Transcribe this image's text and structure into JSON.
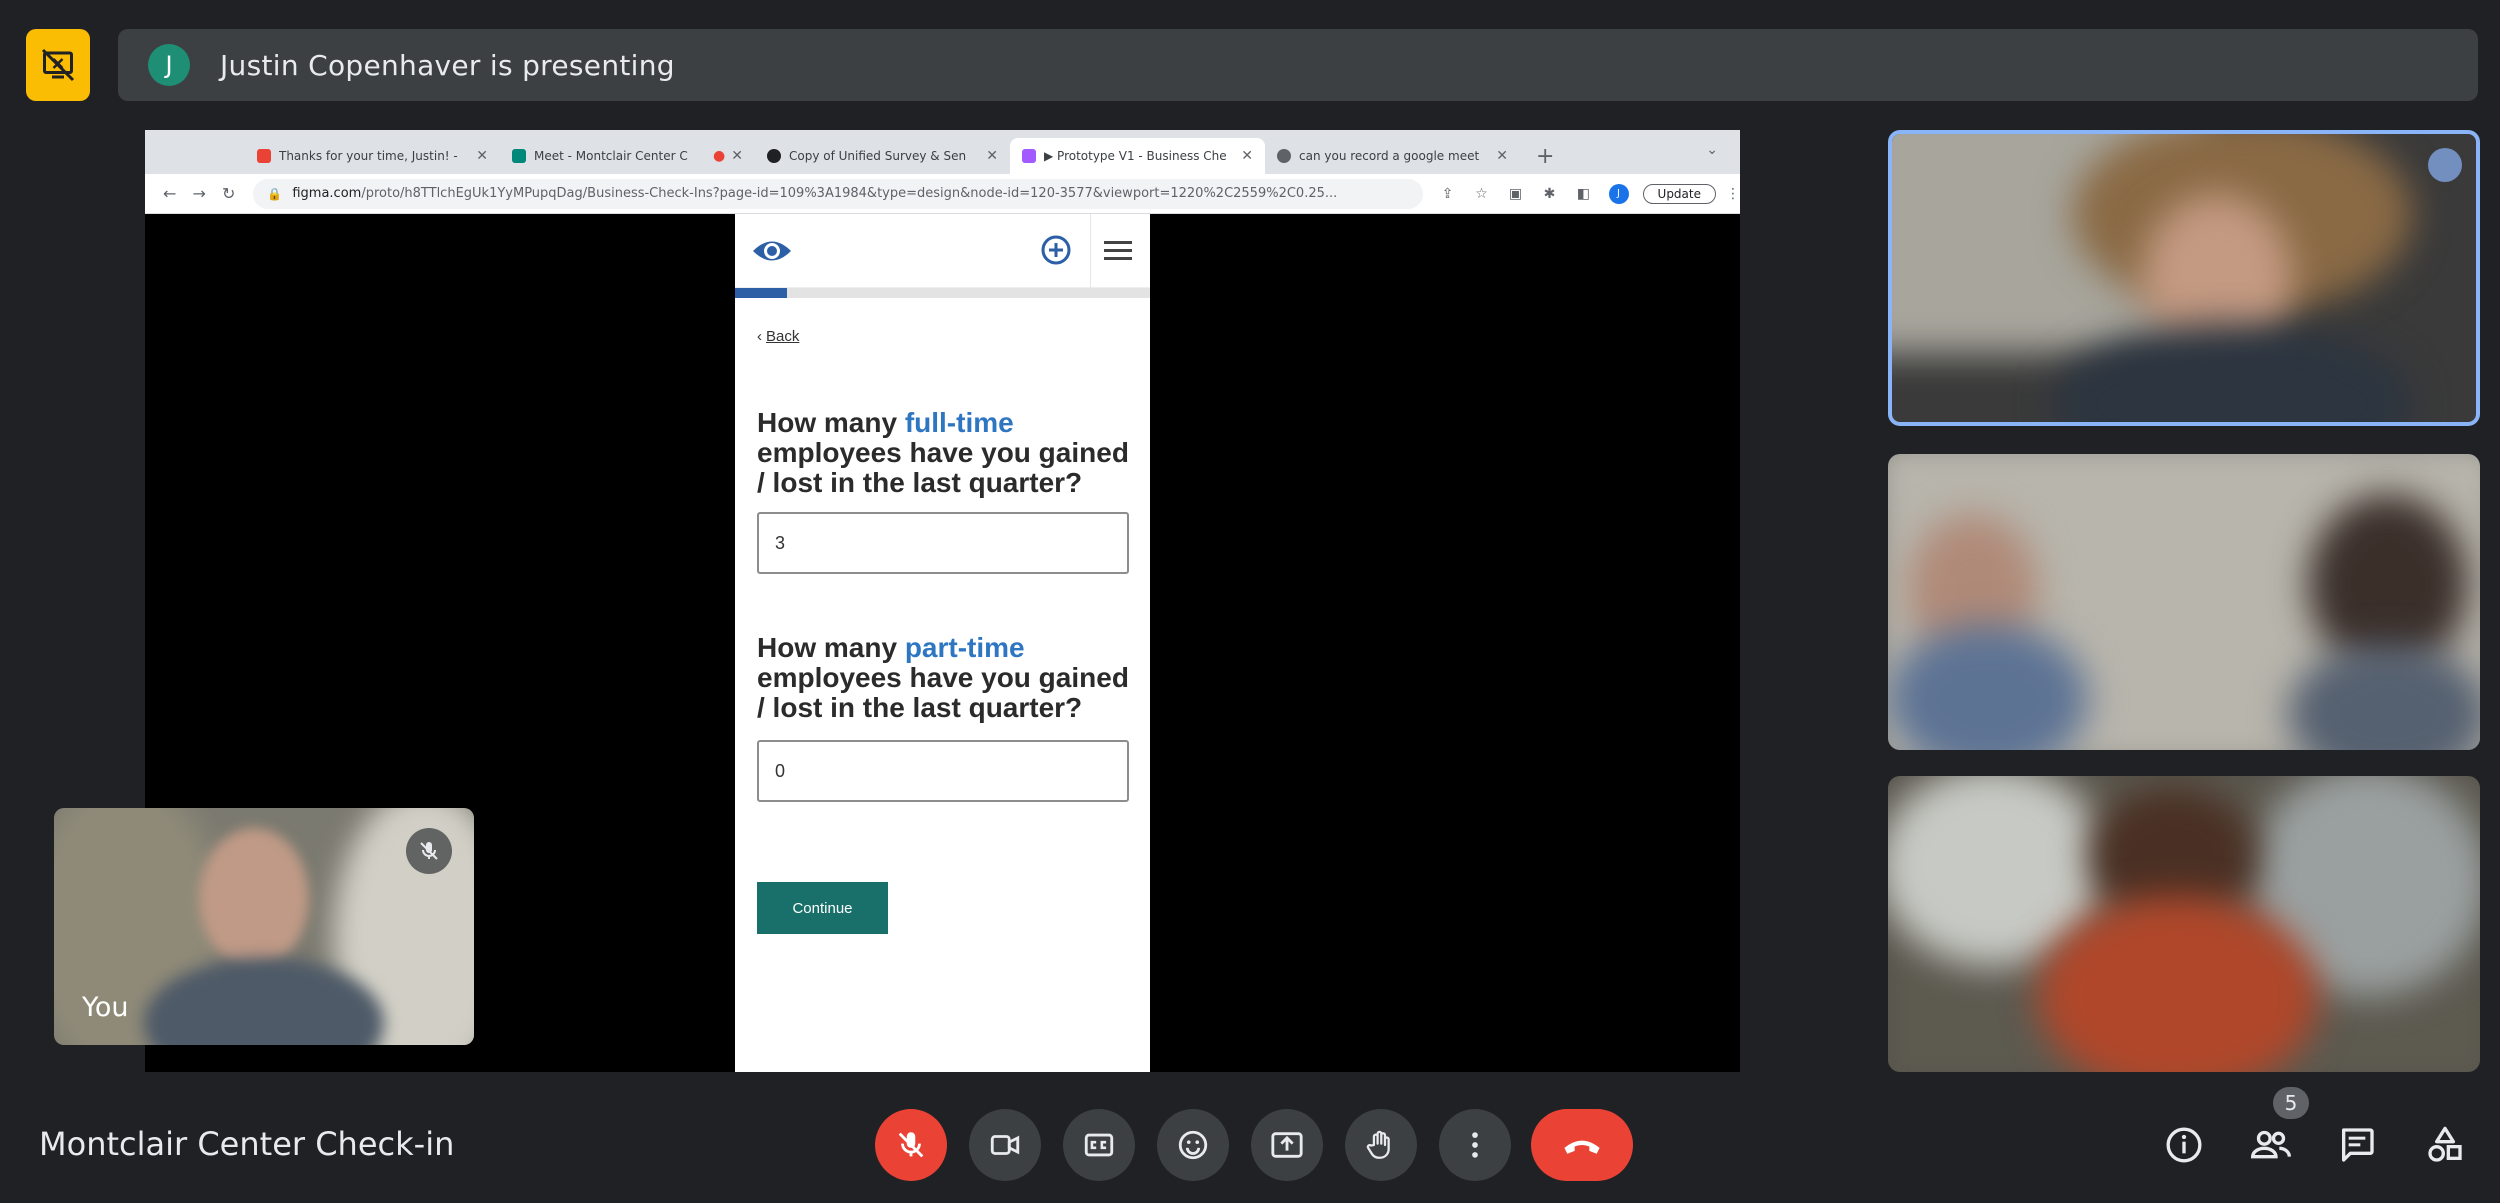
{
  "presenter": {
    "initial": "J",
    "text": "Justin Copenhaver is presenting"
  },
  "browser": {
    "tabs": [
      {
        "label": "Thanks for your time, Justin! -",
        "icon_color": "#ea4335"
      },
      {
        "label": "Meet - Montclair Center C",
        "icon_color": "#00897b"
      },
      {
        "label": "Copy of Unified Survey & Sen",
        "icon_color": "#202124"
      },
      {
        "label": "▶ Prototype V1 - Business Che",
        "icon_color": "#a259ff"
      },
      {
        "label": "can you record a google meet",
        "icon_color": "#5f6368"
      }
    ],
    "url_host": "figma.com",
    "url_path": "/proto/h8TTlchEgUk1YyMPupqDag/Business-Check-Ins?page-id=109%3A1984&type=design&node-id=120-3577&viewport=1220%2C2559%2C0.25...",
    "profile_initial": "J",
    "update_label": "Update"
  },
  "prototype": {
    "progress": 0.125,
    "back_label": "Back",
    "q1": {
      "pre": "How many ",
      "highlight": "full-time",
      "post": " employees have you gained / lost in the last quarter?",
      "value": "3"
    },
    "q2": {
      "pre": "How many ",
      "highlight": "part-time",
      "post": " employees have you gained / lost in the last quarter?",
      "value": "0"
    },
    "continue_label": "Continue"
  },
  "self_view": {
    "label": "You"
  },
  "meeting": {
    "title": "Montclair Center Check-in",
    "participant_count": "5"
  },
  "colors": {
    "accent": "#8ab4f8",
    "end_call": "#ea4335",
    "present_toggle": "#fbbc04"
  }
}
